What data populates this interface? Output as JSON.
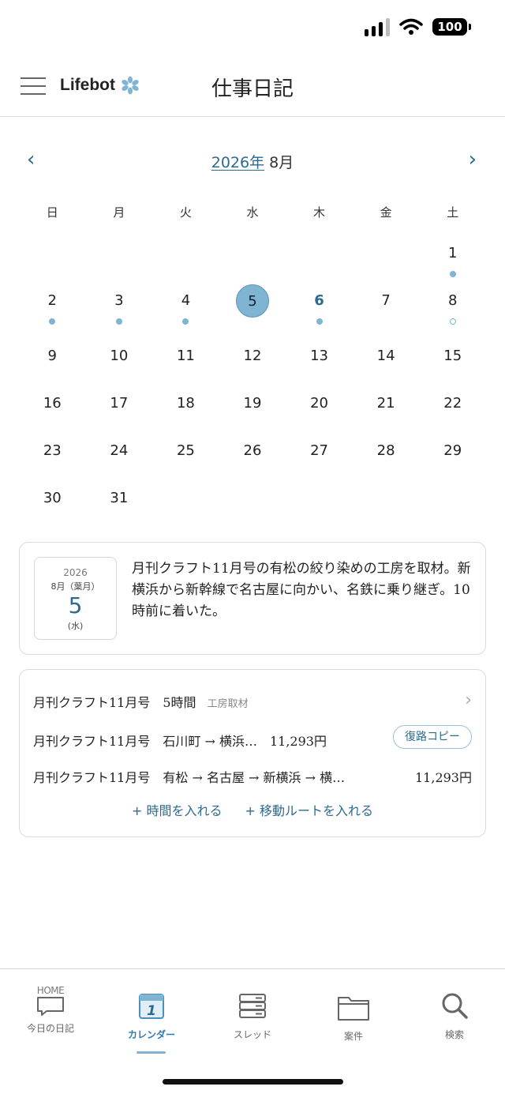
{
  "status_bar": {
    "battery": "100"
  },
  "header": {
    "brand": "Lifebot",
    "title": "仕事日記"
  },
  "calendar": {
    "year_label": "2026年",
    "month_label": "8月",
    "weekdays": [
      "日",
      "月",
      "火",
      "水",
      "木",
      "金",
      "土"
    ],
    "days": [
      "1",
      "2",
      "3",
      "4",
      "5",
      "6",
      "7",
      "8",
      "9",
      "10",
      "11",
      "12",
      "13",
      "14",
      "15",
      "16",
      "17",
      "18",
      "19",
      "20",
      "21",
      "22",
      "23",
      "24",
      "25",
      "26",
      "27",
      "28",
      "29",
      "30",
      "31"
    ],
    "selected_day": "5",
    "today_day": "6"
  },
  "diary": {
    "year": "2026",
    "month": "8月（葉月）",
    "day": "5",
    "weekday": "(水)",
    "text": "月刊クラフト11月号の有松の絞り染めの工房を取材。新横浜から新幹線で名古屋に向かい、名鉄に乗り継ぎ。10時前に着いた。"
  },
  "entries": {
    "time_entry": {
      "project": "月刊クラフト11月号",
      "hours": "5時間",
      "task": "工房取材"
    },
    "route1": {
      "project": "月刊クラフト11月号",
      "route": "石川町 → 横浜…",
      "amount": "11,293円",
      "button": "復路コピー"
    },
    "route2": {
      "project": "月刊クラフト11月号",
      "route": "有松 → 名古屋 → 新横浜 → 横…",
      "amount": "11,293円"
    },
    "add_time": "+ 時間を入れる",
    "add_route": "+ 移動ルートを入れる"
  },
  "tabbar": {
    "home_text": "HOME",
    "items": [
      {
        "label": "今日の日記",
        "icon": "chat-bubble-icon"
      },
      {
        "label": "カレンダー",
        "icon": "calendar-icon"
      },
      {
        "label": "スレッド",
        "icon": "server-stack-icon"
      },
      {
        "label": "案件",
        "icon": "folder-icon"
      },
      {
        "label": "検索",
        "icon": "search-icon"
      }
    ],
    "active_index": 1
  },
  "colors": {
    "accent": "#2e6a8e",
    "selected": "#7fb4d3",
    "tab_active": "#2e7ab4"
  }
}
